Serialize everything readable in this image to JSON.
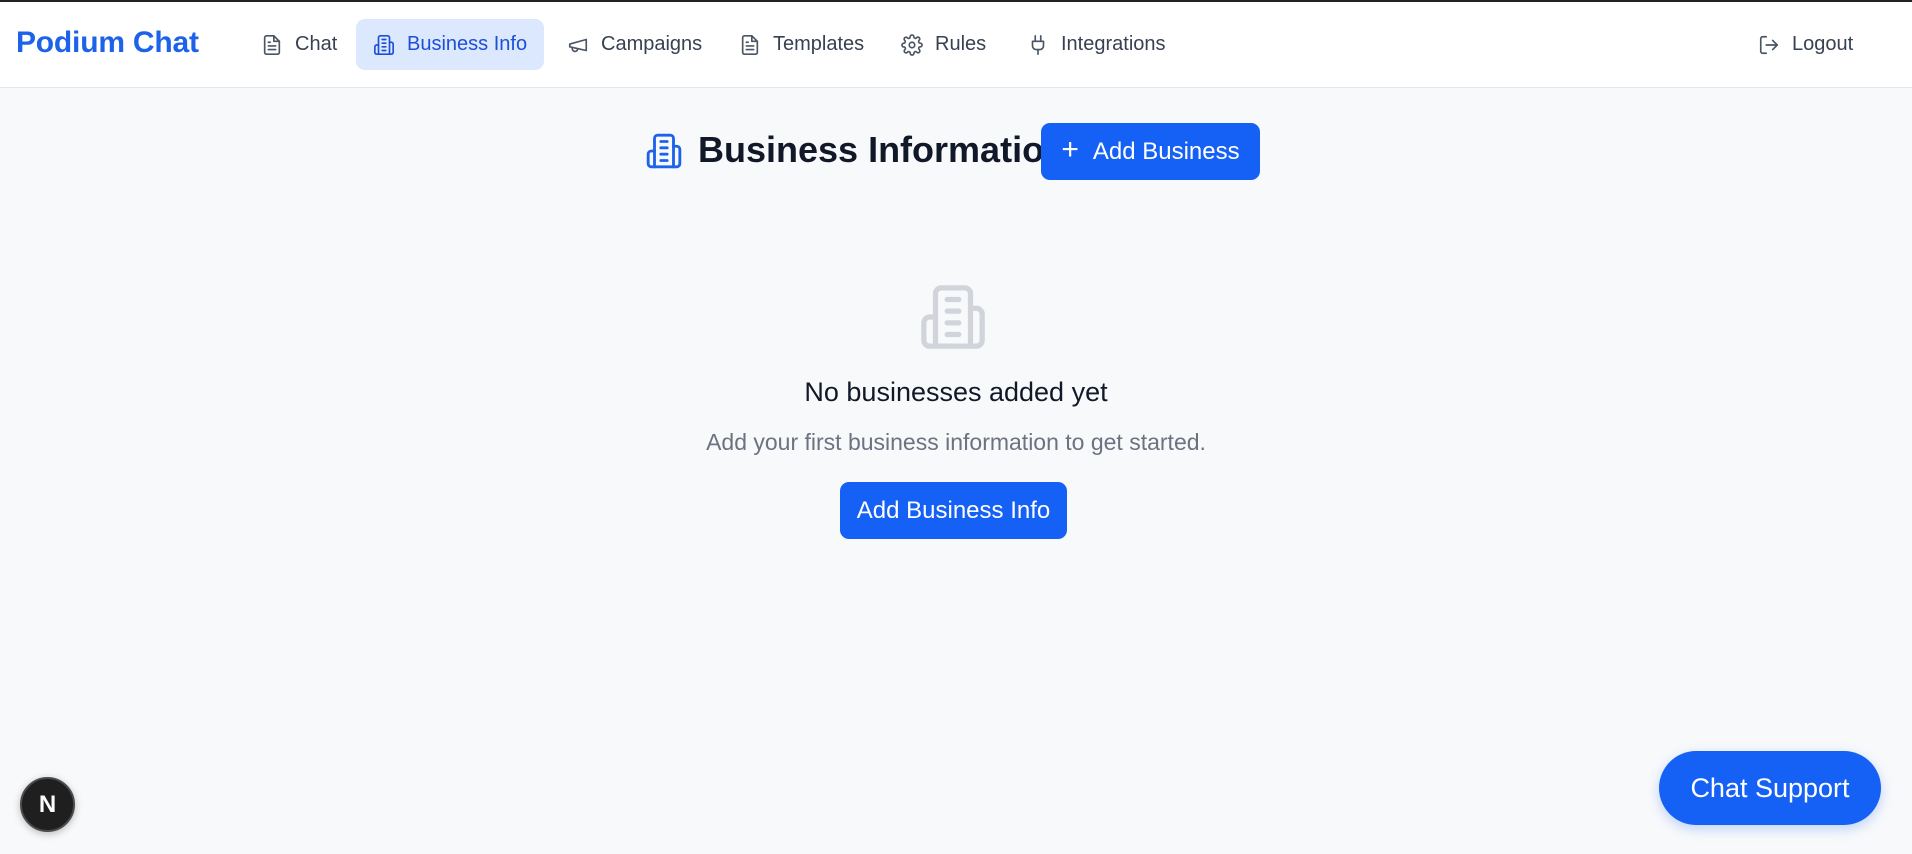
{
  "app": {
    "brand": "Podium Chat"
  },
  "nav": {
    "items": [
      {
        "label": "Chat",
        "icon": "document-icon",
        "active": false
      },
      {
        "label": "Business Info",
        "icon": "building-icon",
        "active": true
      },
      {
        "label": "Campaigns",
        "icon": "megaphone-icon",
        "active": false
      },
      {
        "label": "Templates",
        "icon": "document-icon",
        "active": false
      },
      {
        "label": "Rules",
        "icon": "gear-icon",
        "active": false
      },
      {
        "label": "Integrations",
        "icon": "plug-icon",
        "active": false
      }
    ],
    "logout_label": "Logout"
  },
  "page": {
    "title": "Business Information",
    "add_business_label": "Add Business"
  },
  "empty_state": {
    "title": "No businesses added yet",
    "subtitle": "Add your first business information to get started.",
    "button_label": "Add Business Info"
  },
  "chat_support": {
    "label": "Chat Support"
  },
  "dev_badge": {
    "letter": "N"
  },
  "colors": {
    "accent": "#1560f5",
    "brand": "#1d63ea",
    "active_nav_bg": "#dbe8fd",
    "page_bg": "#f8f9fb"
  }
}
